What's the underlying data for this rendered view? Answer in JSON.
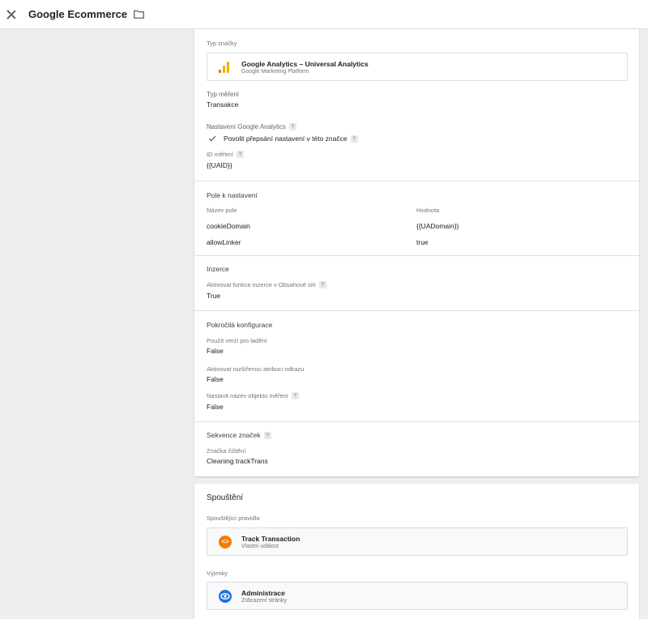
{
  "header": {
    "title": "Google Ecommerce"
  },
  "config": {
    "tag_type_label": "Typ značky",
    "tag_type_name": "Google Analytics – Universal Analytics",
    "tag_type_sub": "Google Marketing Platform",
    "measure_type_label": "Typ měření",
    "measure_type_value": "Transakce",
    "ga_settings_label": "Nastavení Google Analytics",
    "override_label": "Povolit přepsání nastavení v této značce",
    "id_label": "ID měření",
    "id_value": "{{UAID}}",
    "fields_heading": "Pole k nastavení",
    "fields_col_name": "Název pole",
    "fields_col_value": "Hodnota",
    "fields": [
      {
        "name": "cookieDomain",
        "value": "{{UADomain}}"
      },
      {
        "name": "allowLinker",
        "value": "true"
      }
    ],
    "ads_heading": "Inzerce",
    "ads_label": "Aktivovat funkce inzerce v Obsahové síti",
    "ads_value": "True",
    "adv_heading": "Pokročilá konfigurace",
    "debug_label": "Použít verzi pro ladění",
    "debug_value": "False",
    "linkattr_label": "Aktivovat rozšířenou atribuci odkazu",
    "linkattr_value": "False",
    "objname_label": "Nastavit název objektu měření",
    "objname_value": "False",
    "seq_heading": "Sekvence značek",
    "cleanup_label": "Značka čištění",
    "cleanup_value": "Cleaning trackTrans"
  },
  "triggering": {
    "heading": "Spouštění",
    "firing_label": "Spouštějící pravidla",
    "firing_name": "Track Transaction",
    "firing_sub": "Vlastní událost",
    "exceptions_label": "Výjimky",
    "exception_name": "Administrace",
    "exception_sub": "Zobrazení stránky"
  },
  "help_glyph": "?",
  "colors": {
    "accent_orange": "#f57c00",
    "accent_blue": "#1a73e8",
    "ga_yellow": "#f9ab00"
  }
}
